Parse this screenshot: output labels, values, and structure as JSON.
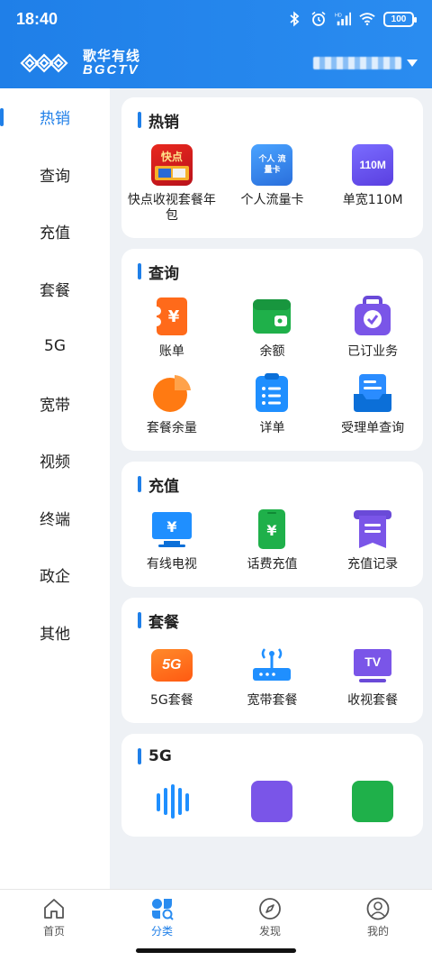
{
  "status_bar": {
    "time": "18:40",
    "battery": "100"
  },
  "brand": {
    "name_cn": "歌华有线",
    "name_en": "BGCTV"
  },
  "sidebar": {
    "items": [
      {
        "label": "热销",
        "active": true
      },
      {
        "label": "查询"
      },
      {
        "label": "充值"
      },
      {
        "label": "套餐"
      },
      {
        "label": "5G"
      },
      {
        "label": "宽带"
      },
      {
        "label": "视频"
      },
      {
        "label": "终端"
      },
      {
        "label": "政企"
      },
      {
        "label": "其他"
      }
    ]
  },
  "sections": [
    {
      "title": "热销",
      "items": [
        {
          "label": "快点收视套餐年包",
          "icon": "kuaidian-package-icon",
          "icon_text": "快点"
        },
        {
          "label": "个人流量卡",
          "icon": "data-card-icon",
          "icon_text": "个人 流量卡"
        },
        {
          "label": "单宽110M",
          "icon": "broadband-110m-icon",
          "icon_text": "110M"
        }
      ]
    },
    {
      "title": "查询",
      "items": [
        {
          "label": "账单",
          "icon": "bill-icon"
        },
        {
          "label": "余额",
          "icon": "wallet-icon"
        },
        {
          "label": "已订业务",
          "icon": "subscribed-icon"
        },
        {
          "label": "套餐余量",
          "icon": "pie-chart-icon"
        },
        {
          "label": "详单",
          "icon": "clipboard-list-icon"
        },
        {
          "label": "受理单查询",
          "icon": "document-tray-icon"
        }
      ]
    },
    {
      "title": "充值",
      "items": [
        {
          "label": "有线电视",
          "icon": "tv-yuan-icon"
        },
        {
          "label": "话费充值",
          "icon": "phone-yuan-icon"
        },
        {
          "label": "充值记录",
          "icon": "receipt-icon"
        }
      ]
    },
    {
      "title": "套餐",
      "items": [
        {
          "label": "5G套餐",
          "icon": "5g-icon",
          "icon_text": "5G"
        },
        {
          "label": "宽带套餐",
          "icon": "router-icon"
        },
        {
          "label": "收视套餐",
          "icon": "tv-icon",
          "icon_text": "TV"
        }
      ]
    },
    {
      "title": "5G",
      "items": []
    }
  ],
  "bottom_nav": [
    {
      "label": "首页",
      "icon": "home-icon"
    },
    {
      "label": "分类",
      "icon": "category-icon",
      "active": true
    },
    {
      "label": "发现",
      "icon": "compass-icon"
    },
    {
      "label": "我的",
      "icon": "user-icon"
    }
  ]
}
